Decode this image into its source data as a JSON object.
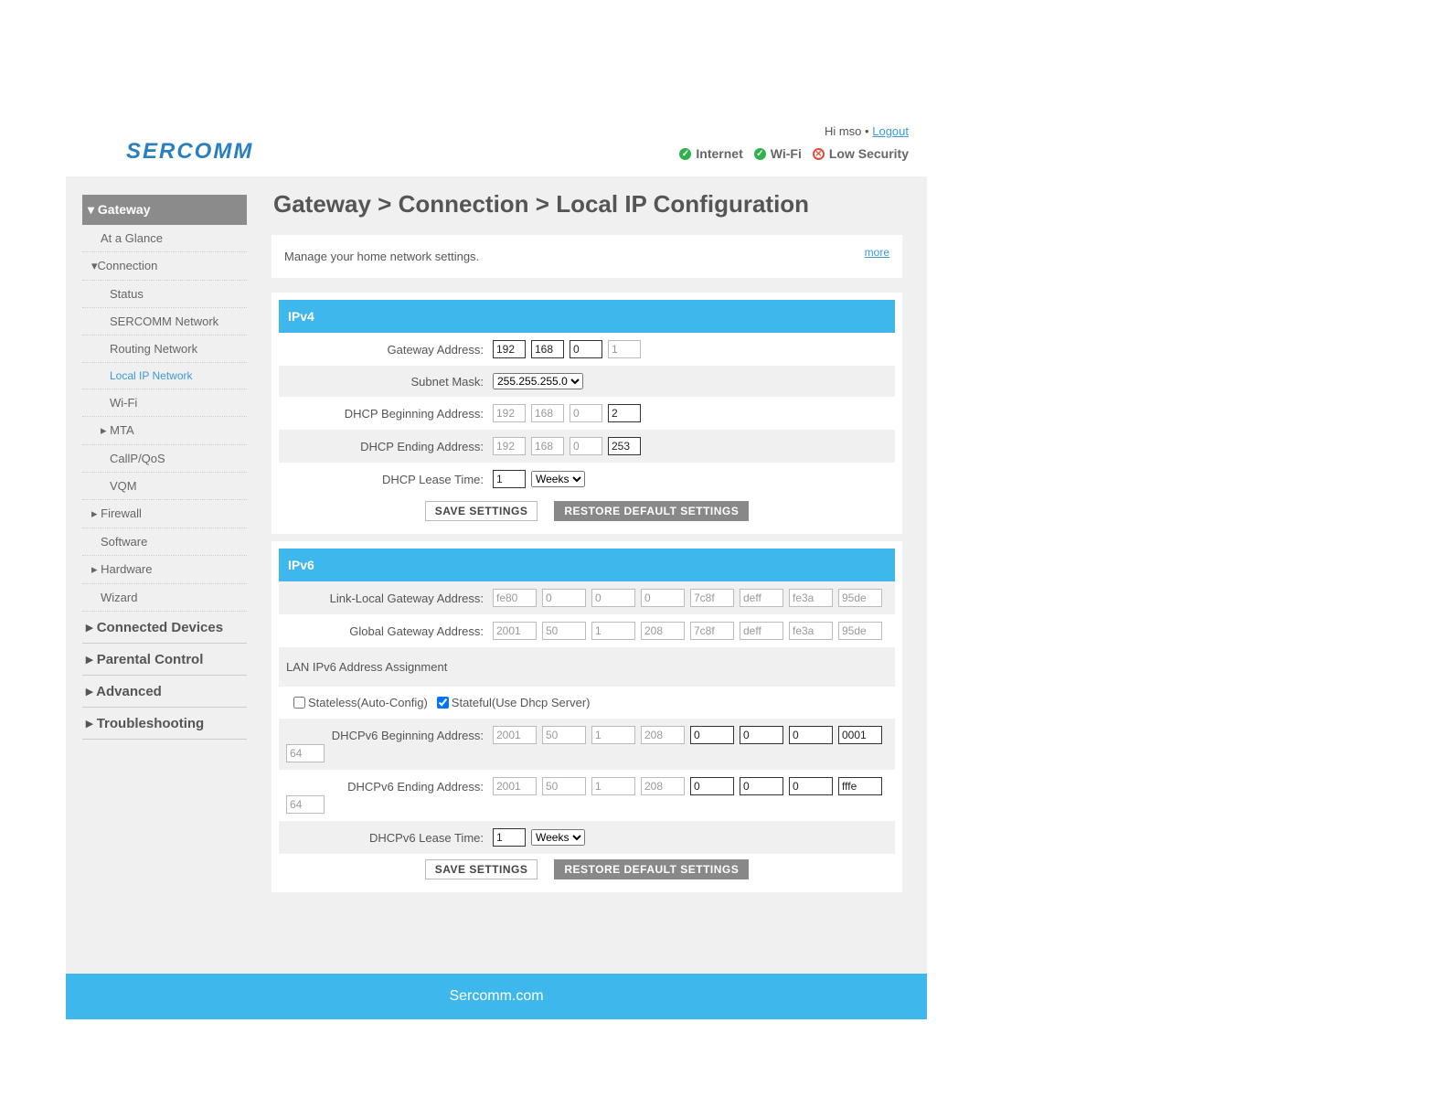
{
  "brand": "SERCOMM",
  "user": {
    "greeting": "Hi mso",
    "sep": "•",
    "logout": "Logout"
  },
  "status": {
    "internet": "Internet",
    "wifi": "Wi-Fi",
    "security": "Low Security"
  },
  "sidebar": {
    "gateway": "Gateway",
    "items": [
      "At a Glance",
      "Connection",
      "Status",
      "SERCOMM Network",
      "Routing Network",
      "Local IP Network",
      "Wi-Fi",
      "MTA",
      "CallP/QoS",
      "VQM",
      "Firewall",
      "Software",
      "Hardware",
      "Wizard"
    ],
    "sections": [
      "Connected Devices",
      "Parental Control",
      "Advanced",
      "Troubleshooting"
    ]
  },
  "page": {
    "title": "Gateway > Connection > Local IP Configuration",
    "intro": "Manage your home network settings.",
    "more": "more"
  },
  "ipv4": {
    "heading": "IPv4",
    "gateway_label": "Gateway Address:",
    "gateway": [
      "192",
      "168",
      "0",
      "1"
    ],
    "subnet_label": "Subnet Mask:",
    "subnet": "255.255.255.0",
    "dhcp_begin_label": "DHCP Beginning Address:",
    "dhcp_begin": [
      "192",
      "168",
      "0",
      "2"
    ],
    "dhcp_end_label": "DHCP Ending Address:",
    "dhcp_end": [
      "192",
      "168",
      "0",
      "253"
    ],
    "lease_label": "DHCP Lease Time:",
    "lease_value": "1",
    "lease_unit": "Weeks",
    "save": "SAVE SETTINGS",
    "restore": "RESTORE DEFAULT SETTINGS"
  },
  "ipv6": {
    "heading": "IPv6",
    "link_local_label": "Link-Local Gateway Address:",
    "link_local": [
      "fe80",
      "0",
      "0",
      "0",
      "7c8f",
      "deff",
      "fe3a",
      "95de"
    ],
    "global_label": "Global Gateway Address:",
    "global": [
      "2001",
      "50",
      "1",
      "208",
      "7c8f",
      "deff",
      "fe3a",
      "95de"
    ],
    "assignment_label": "LAN IPv6 Address Assignment",
    "stateless": "Stateless(Auto-Config)",
    "stateful": "Stateful(Use Dhcp Server)",
    "begin_label": "DHCPv6 Beginning Address:",
    "begin": [
      "2001",
      "50",
      "1",
      "208",
      "0",
      "0",
      "0",
      "0001"
    ],
    "begin_prefix": "64",
    "end_label": "DHCPv6 Ending Address:",
    "end": [
      "2001",
      "50",
      "1",
      "208",
      "0",
      "0",
      "0",
      "fffe"
    ],
    "end_prefix": "64",
    "lease_label": "DHCPv6 Lease Time:",
    "lease_value": "1",
    "lease_unit": "Weeks",
    "save": "SAVE SETTINGS",
    "restore": "RESTORE DEFAULT SETTINGS"
  },
  "footer": "Sercomm.com",
  "colors": {
    "accent": "#3db7ec",
    "logo": "#2a7fc1"
  }
}
